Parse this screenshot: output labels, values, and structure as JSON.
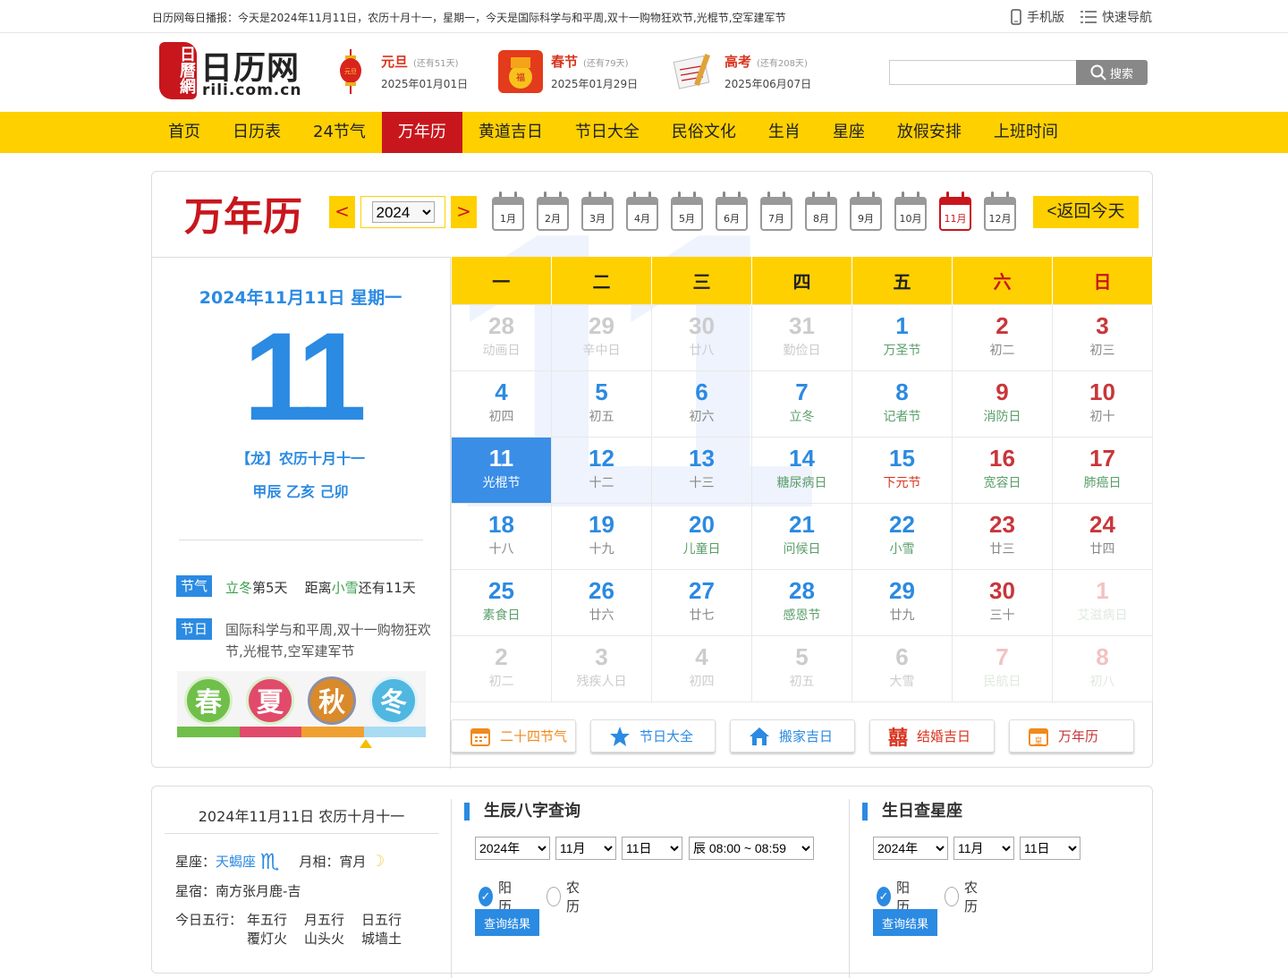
{
  "topbar": {
    "ticker": "日历网每日播报：今天是2024年11月11日，农历十月十一，星期一，今天是国际科学与和平周,双十一购物狂欢节,光棍节,空军建军节",
    "mobile": "手机版",
    "nav": "快速导航"
  },
  "logo": {
    "seal": "日曆網",
    "name": "日历网",
    "domain": "rili.com.cn"
  },
  "countdowns": [
    {
      "name": "元旦",
      "left": "(还有51天)",
      "date": "2025年01月01日"
    },
    {
      "name": "春节",
      "left": "(还有79天)",
      "date": "2025年01月29日"
    },
    {
      "name": "高考",
      "left": "(还有208天)",
      "date": "2025年06月07日"
    }
  ],
  "search": {
    "placeholder": "",
    "button": "搜索"
  },
  "nav": [
    "首页",
    "日历表",
    "24节气",
    "万年历",
    "黄道吉日",
    "节日大全",
    "民俗文化",
    "生肖",
    "星座",
    "放假安排",
    "上班时间"
  ],
  "calendar": {
    "title": "万年历",
    "prev": "<",
    "next": ">",
    "year": "2024",
    "months": [
      "1月",
      "2月",
      "3月",
      "4月",
      "5月",
      "6月",
      "7月",
      "8月",
      "9月",
      "10月",
      "11月",
      "12月"
    ],
    "today_btn": "<返回今天",
    "weekdays": [
      "一",
      "二",
      "三",
      "四",
      "五",
      "六",
      "日"
    ],
    "watermark": "11",
    "rows": [
      [
        {
          "d": "28",
          "l": "动画日",
          "o": 1
        },
        {
          "d": "29",
          "l": "辛中日",
          "o": 1
        },
        {
          "d": "30",
          "l": "廿八",
          "o": 1
        },
        {
          "d": "31",
          "l": "勤俭日",
          "o": 1
        },
        {
          "d": "1",
          "l": "万圣节",
          "c": "b"
        },
        {
          "d": "2",
          "l": "初二"
        },
        {
          "d": "3",
          "l": "初三"
        }
      ],
      [
        {
          "d": "4",
          "l": "初四"
        },
        {
          "d": "5",
          "l": "初五"
        },
        {
          "d": "6",
          "l": "初六"
        },
        {
          "d": "7",
          "l": "立冬",
          "c": "g"
        },
        {
          "d": "8",
          "l": "记者节",
          "c": "g"
        },
        {
          "d": "9",
          "l": "消防日",
          "c": "g"
        },
        {
          "d": "10",
          "l": "初十"
        }
      ],
      [
        {
          "d": "11",
          "l": "光棍节",
          "s": 1
        },
        {
          "d": "12",
          "l": "十二"
        },
        {
          "d": "13",
          "l": "十三"
        },
        {
          "d": "14",
          "l": "糖尿病日",
          "c": "g"
        },
        {
          "d": "15",
          "l": "下元节",
          "c": "r"
        },
        {
          "d": "16",
          "l": "宽容日",
          "c": "g"
        },
        {
          "d": "17",
          "l": "肺癌日",
          "c": "g"
        }
      ],
      [
        {
          "d": "18",
          "l": "十八"
        },
        {
          "d": "19",
          "l": "十九"
        },
        {
          "d": "20",
          "l": "儿童日",
          "c": "g"
        },
        {
          "d": "21",
          "l": "问候日",
          "c": "g"
        },
        {
          "d": "22",
          "l": "小雪",
          "c": "g"
        },
        {
          "d": "23",
          "l": "廿三"
        },
        {
          "d": "24",
          "l": "廿四"
        }
      ],
      [
        {
          "d": "25",
          "l": "素食日",
          "c": "g"
        },
        {
          "d": "26",
          "l": "廿六"
        },
        {
          "d": "27",
          "l": "廿七"
        },
        {
          "d": "28",
          "l": "感恩节",
          "c": "g"
        },
        {
          "d": "29",
          "l": "廿九"
        },
        {
          "d": "30",
          "l": "三十"
        },
        {
          "d": "1",
          "l": "艾滋病日",
          "o": 1
        }
      ],
      [
        {
          "d": "2",
          "l": "初二",
          "o": 1
        },
        {
          "d": "3",
          "l": "残疾人日",
          "o": 1
        },
        {
          "d": "4",
          "l": "初四",
          "o": 1
        },
        {
          "d": "5",
          "l": "初五",
          "o": 1
        },
        {
          "d": "6",
          "l": "大雪",
          "o": 1
        },
        {
          "d": "7",
          "l": "民航日",
          "o": 1
        },
        {
          "d": "8",
          "l": "初八",
          "o": 1
        }
      ]
    ]
  },
  "today": {
    "date": "2024年11月11日 星期一",
    "day": "11",
    "lunar": "【龙】农历十月十一",
    "ganzhi": "甲辰 乙亥 己卯",
    "jieqi_tag": "节气",
    "jieqi_name": "立冬",
    "jieqi_day": "第5天",
    "jieqi_dist": "距离",
    "jieqi_next": "小雪",
    "jieqi_left": "还有11天",
    "jieri_tag": "节日",
    "jieri": "国际科学与和平周,双十一购物狂欢节,光棍节,空军建军节",
    "seasons": [
      "春",
      "夏",
      "秋",
      "冬"
    ]
  },
  "quick": [
    "二十四节气",
    "节日大全",
    "搬家吉日",
    "结婚吉日",
    "万年历"
  ],
  "info": {
    "header": "2024年11月11日 农历十月十一",
    "xingzuo_label": "星座：",
    "xingzuo": "天蝎座",
    "yuexiang_label": "月相：",
    "yuexiang": "宵月",
    "xingxiu_label": "星宿：",
    "xingxiu": "南方张月鹿-吉",
    "wuxing_label": "今日五行：",
    "wuxing": [
      {
        "h": "年五行",
        "v": "覆灯火"
      },
      {
        "h": "月五行",
        "v": "山头火"
      },
      {
        "h": "日五行",
        "v": "城墙土"
      }
    ]
  },
  "bazi": {
    "title": "生辰八字查询",
    "year": "2024年",
    "month": "11月",
    "day": "11日",
    "hour": "辰 08:00 ~ 08:59",
    "solar": "阳历",
    "lunar": "农历",
    "btn": "查询结果"
  },
  "birthday": {
    "title": "生日查星座",
    "year": "2024年",
    "month": "11月",
    "day": "11日",
    "solar": "阳历",
    "lunar": "农历",
    "btn": "查询结果"
  },
  "colors": {
    "accent": "#fed000",
    "brand": "#c8161d",
    "blue": "#2b8ae2"
  }
}
